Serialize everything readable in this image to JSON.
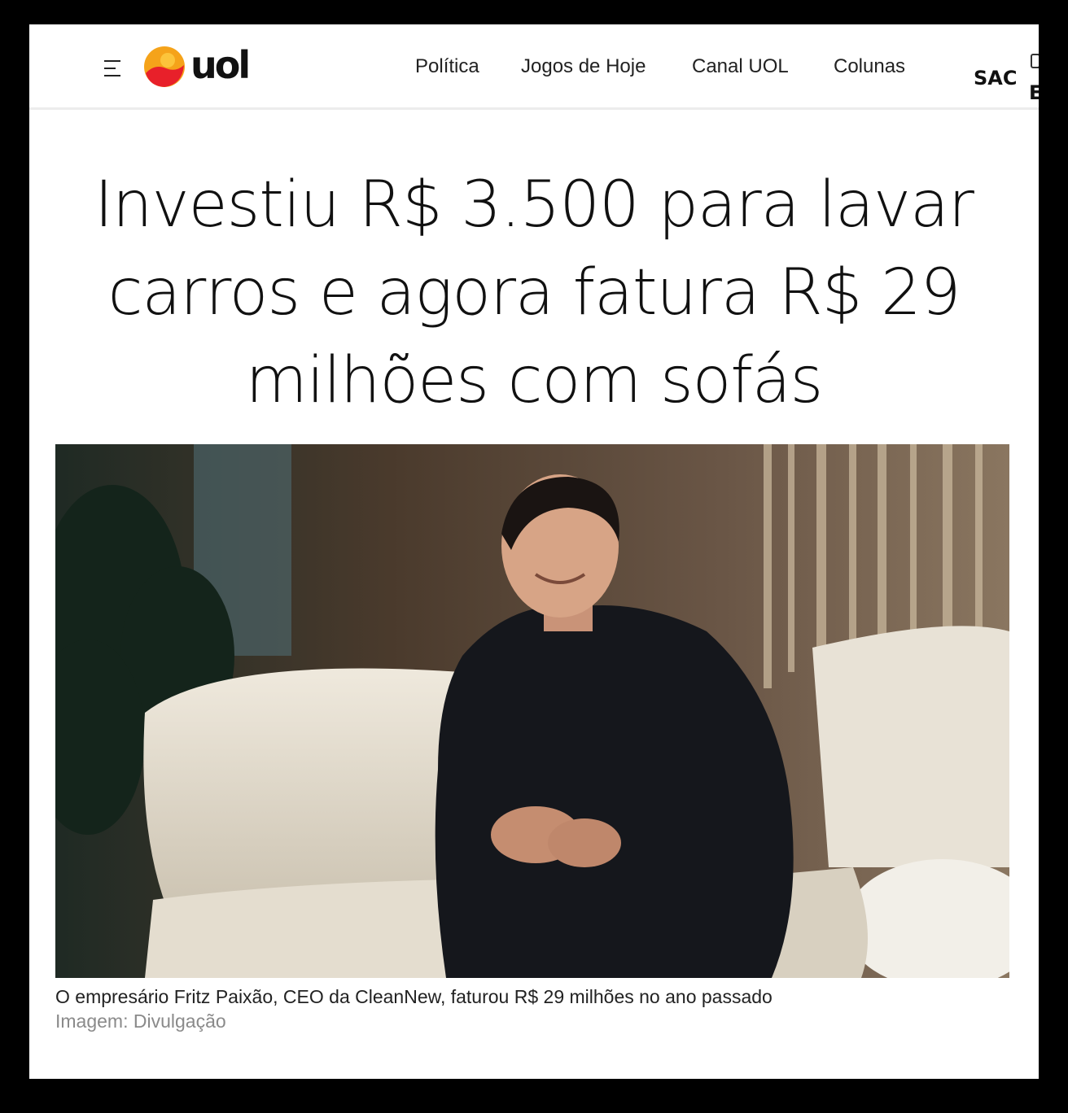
{
  "header": {
    "logo_text": "uol",
    "nav": [
      {
        "label": "Política"
      },
      {
        "label": "Jogos de Hoje"
      },
      {
        "label": "Canal UOL"
      },
      {
        "label": "Colunas"
      }
    ],
    "sac_label": "SAC"
  },
  "article": {
    "headline": "Investiu R$ 3.500 para lavar carros e agora fatura R$ 29 milhões com sofás",
    "caption": "O empresário Fritz Paixão, CEO da CleanNew, faturou R$ 29 milhões no ano passado",
    "credit": "Imagem: Divulgação"
  },
  "colors": {
    "logo_orange": "#f5a31a",
    "logo_red": "#e8202a",
    "background": "#ffffff",
    "frame": "#000000"
  },
  "icons": [
    "menu-icon",
    "uol-logo-icon"
  ]
}
